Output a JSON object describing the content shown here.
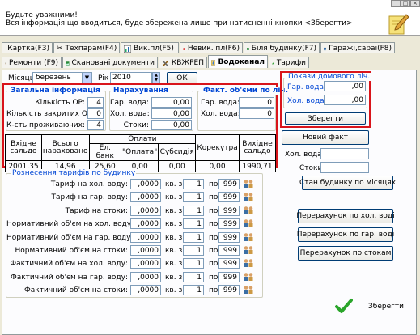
{
  "header": {
    "line1": "Будьте уважними!",
    "line2": "Вся інформація що вводиться, буде збережена лише при натисненні кнопки <Зберегти>",
    "window_buttons": [
      "_",
      "□",
      "×"
    ]
  },
  "tabs_row1": [
    {
      "label": "Картка(F3)",
      "icon": "card-icon"
    },
    {
      "label": "Техпарам(F4)",
      "icon": "scissors-icon"
    },
    {
      "label": "Вик.пл(F5)",
      "icon": "chart-icon"
    },
    {
      "label": "Невик. пл(F6)",
      "icon": "no-entry-icon"
    },
    {
      "label": "Біля будинку(F7)",
      "icon": "house-icon"
    },
    {
      "label": "Гаражі,сараї(F8)",
      "icon": "garage-icon"
    }
  ],
  "tabs_row2": [
    {
      "label": "Ремонти (F9)",
      "icon": "hammer-icon"
    },
    {
      "label": "Скановані документи",
      "icon": "image-icon"
    },
    {
      "label": "КВЖРЕП",
      "icon": "tools-icon"
    },
    {
      "label": "Водоканал",
      "icon": "water-icon",
      "active": true
    },
    {
      "label": "Тарифи",
      "icon": "leaf-icon"
    }
  ],
  "period": {
    "month_label": "Місяць",
    "month_value": "березень",
    "year_label": "Рік",
    "year_value": "2010",
    "ok_label": "ОК"
  },
  "general": {
    "title": "Загальна інформація",
    "open_label": "Кількість ОР:",
    "open_value": "4",
    "closed_label": "Кількість закритих ОР:",
    "closed_value": "0",
    "residents_label": "К-сть проживаючих:",
    "residents_value": "4"
  },
  "charges": {
    "title": "Нарахування",
    "hot_label": "Гар. вода:",
    "hot_value": "0,00",
    "cold_label": "Хол. вода:",
    "cold_value": "0,00",
    "sewer_label": "Стоки:",
    "sewer_value": "0,00"
  },
  "actual": {
    "title": "Факт. об'єми по ліч.",
    "hot_label": "Гар. вода:",
    "hot_value": "0",
    "cold_label": "Хол. вода:",
    "cold_value": "0"
  },
  "meter": {
    "title": "Покази домового ліч.",
    "hot_label": "Гар. вода:",
    "hot_value": ",00",
    "cold_label": "Хол. вода:",
    "cold_value": ",00",
    "save_label": "Зберегти"
  },
  "balance": {
    "col_in": [
      "Вхідне",
      "сальдо"
    ],
    "col_total": [
      "Всього",
      "нараховано"
    ],
    "col_pay": "Оплати",
    "col_bank": "Ел. банк",
    "col_payment": "\"Оплата\"",
    "col_subsidy": "Субсидія",
    "col_corr": "Корекутра",
    "col_out": [
      "Вихідне",
      "сальдо"
    ],
    "v_in": "2001,35",
    "v_total": "14,96",
    "v_bank": "25,60",
    "v_payment": "0,00",
    "v_subsidy": "0,00",
    "v_corr": "0,00",
    "v_out": "1990,71"
  },
  "new_fact": {
    "button_label": "Новий факт",
    "cold_label": "Хол. вода:",
    "sewer_label": "Стоки:"
  },
  "tariffs": {
    "title": "Рознесення тарифів по будинку",
    "apt_label": "кв. з",
    "to_label": "по",
    "rows": [
      {
        "label": "Тариф на хол. воду:",
        "value": ",0000",
        "from": "1",
        "to": "999"
      },
      {
        "label": "Тариф на гар. воду:",
        "value": ",0000",
        "from": "1",
        "to": "999"
      },
      {
        "label": "Тариф на стоки:",
        "value": ",0000",
        "from": "1",
        "to": "999"
      },
      {
        "label": "Нормативний об'єм на хол. воду:",
        "value": ",0000",
        "from": "1",
        "to": "999"
      },
      {
        "label": "Нормативний об'єм на гар. воду:",
        "value": ",0000",
        "from": "1",
        "to": "999"
      },
      {
        "label": "Нормативний об'єм на стоки:",
        "value": ",0000",
        "from": "1",
        "to": "999"
      },
      {
        "label": "Фактичний об'єм на хол. воду:",
        "value": ",0000",
        "from": "1",
        "to": "999"
      },
      {
        "label": "Фактичний об'єм на гар. воду:",
        "value": ",0000",
        "from": "1",
        "to": "999"
      },
      {
        "label": "Фактичний об'єм на стоки:",
        "value": ",0000",
        "from": "1",
        "to": "999"
      }
    ]
  },
  "actions": {
    "building_state": "Стан будинку по місяцях",
    "recalc_cold": "Перерахунок по хол. воді",
    "recalc_hot": "Перерахунок по гар. воді",
    "recalc_sewer": "Перерахунок по стокам",
    "save": "Зберегти"
  },
  "colors": {
    "highlight": "#d9141b",
    "group_title": "#0046d5",
    "check": "#2aa52a"
  }
}
